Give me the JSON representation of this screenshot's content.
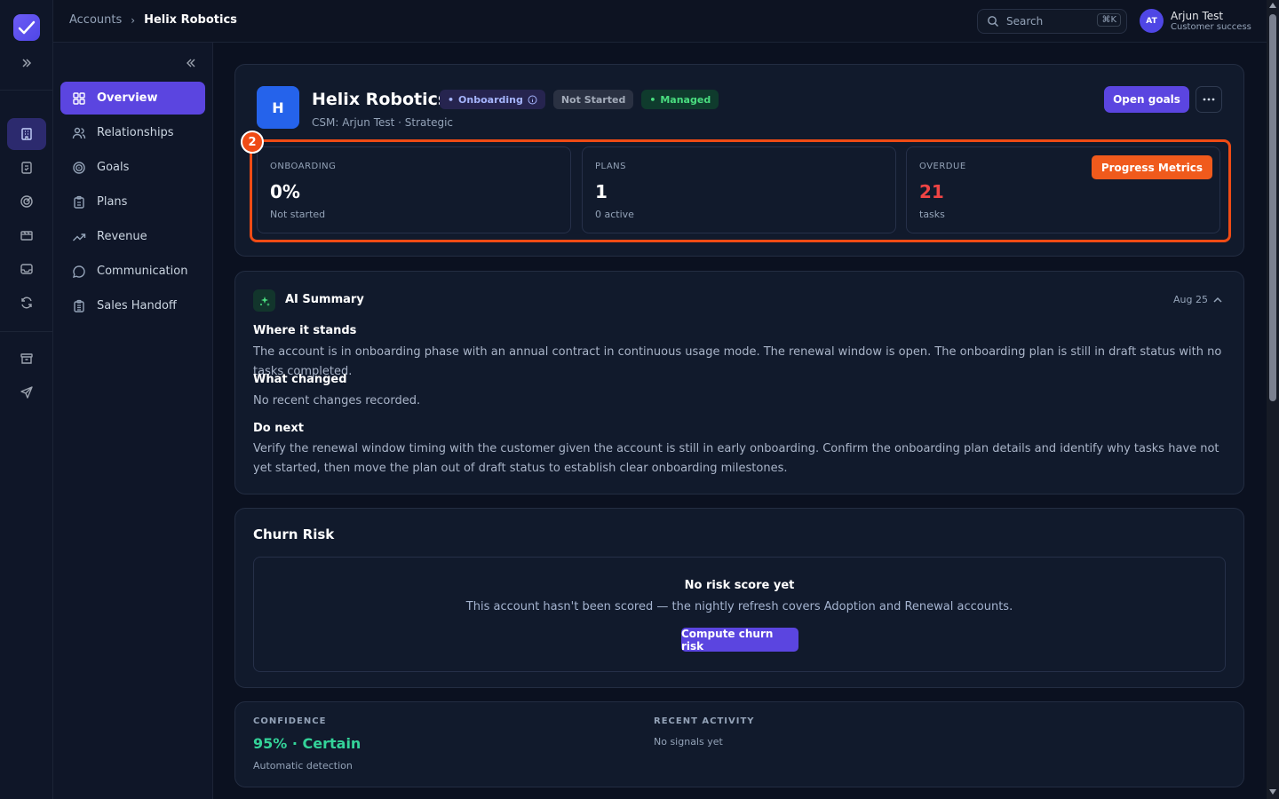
{
  "topbar": {
    "breadcrumbs": [
      "Accounts",
      "Helix Robotics"
    ],
    "search_placeholder": "Search",
    "search_shortcut": "⌘K",
    "user": {
      "initials": "AT",
      "name": "Arjun Test",
      "role": "Customer success"
    }
  },
  "rail": {
    "icons": [
      "accounts-icon",
      "tasks-icon",
      "goals-icon",
      "sprints-icon",
      "inbox-icon",
      "sync-icon",
      "archive-icon",
      "send-icon"
    ],
    "active": "accounts-icon"
  },
  "sidebar": {
    "items": [
      {
        "label": "Overview",
        "icon": "grid-icon",
        "active": true
      },
      {
        "label": "Relationships",
        "icon": "users-icon"
      },
      {
        "label": "Goals",
        "icon": "target-icon"
      },
      {
        "label": "Plans",
        "icon": "clipboard-icon"
      },
      {
        "label": "Revenue",
        "icon": "trend-icon"
      },
      {
        "label": "Communication",
        "icon": "chat-icon"
      },
      {
        "label": "Sales Handoff",
        "icon": "clipboard-list-icon"
      }
    ]
  },
  "account": {
    "initial": "H",
    "name": "Helix Robotics",
    "badges": {
      "stage": "Onboarding",
      "status": "Not Started",
      "type": "Managed"
    },
    "subtitle": "CSM: Arjun Test · Strategic",
    "open_goals_label": "Open goals",
    "annotation_number": "2",
    "metrics": [
      {
        "label": "ONBOARDING",
        "value": "0%",
        "sub": "Not started"
      },
      {
        "label": "PLANS",
        "value": "1",
        "sub": "0 active"
      },
      {
        "label": "OVERDUE",
        "value": "21",
        "sub": "tasks",
        "tag": "Progress Metrics"
      }
    ]
  },
  "ai_summary": {
    "title": "AI Summary",
    "date": "Aug 25",
    "sections": [
      {
        "heading": "Where it stands",
        "text": "The account is in onboarding phase with an annual contract in continuous usage mode. The renewal window is open. The onboarding plan is still in draft status with no tasks completed."
      },
      {
        "heading": "What changed",
        "text": "No recent changes recorded."
      },
      {
        "heading": "Do next",
        "text": "Verify the renewal window timing with the customer given the account is still in early onboarding. Confirm the onboarding plan details and identify why tasks have not yet started, then move the plan out of draft status to establish clear onboarding milestones."
      }
    ]
  },
  "churn_risk": {
    "title": "Churn Risk",
    "empty_title": "No risk score yet",
    "empty_text": "This account hasn't been scored — the nightly refresh covers Adoption and Renewal accounts.",
    "button_label": "Compute churn risk"
  },
  "confidence": {
    "label": "CONFIDENCE",
    "value": "95% · Certain",
    "sub": "Automatic detection",
    "activity_label": "RECENT ACTIVITY",
    "activity_text": "No signals yet"
  },
  "colors": {
    "accent": "#5b45e0",
    "highlight": "#ef4b15",
    "overdue": "#ef4444",
    "success": "#34d399"
  }
}
